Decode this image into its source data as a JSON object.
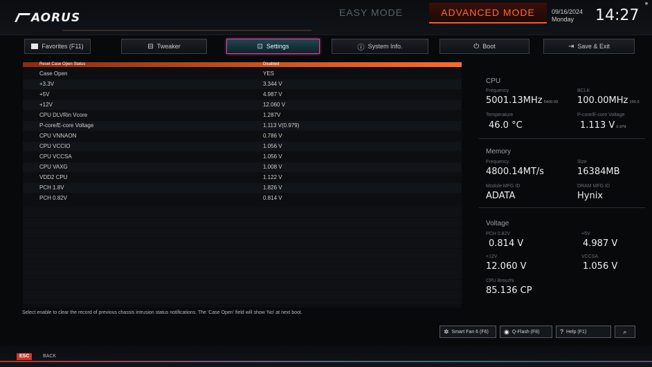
{
  "header": {
    "logo": "AORUS",
    "easy_mode": "EASY MODE",
    "advanced_mode": "ADVANCED MODE",
    "date": "09/16/2024",
    "day": "Monday",
    "time": "14:27"
  },
  "tabs": [
    {
      "label": "Favorites (F11)",
      "icon": "favorites-icon"
    },
    {
      "label": "Tweaker",
      "icon": "tweaker-icon"
    },
    {
      "label": "Settings",
      "icon": "settings-icon",
      "active": true
    },
    {
      "label": "System Info.",
      "icon": "info-icon"
    },
    {
      "label": "Boot",
      "icon": "power-icon"
    },
    {
      "label": "Save & Exit",
      "icon": "exit-icon"
    }
  ],
  "list": {
    "selected": {
      "name": "Reset Case Open Status",
      "value": "Disabled"
    },
    "rows": [
      {
        "name": "Case Open",
        "value": "YES"
      },
      {
        "name": "+3.3V",
        "value": "3.344 V"
      },
      {
        "name": "+5V",
        "value": "4.987 V"
      },
      {
        "name": "+12V",
        "value": "12.060 V"
      },
      {
        "name": "CPU DLVRin Vcore",
        "value": "1.287V"
      },
      {
        "name": "P-core/E-core Voltage",
        "value": "1.113 V(0.979)"
      },
      {
        "name": "CPU VNNAON",
        "value": "0.786 V"
      },
      {
        "name": "CPU VCCIO",
        "value": "1.056 V"
      },
      {
        "name": "CPU VCCSA",
        "value": "1.056 V"
      },
      {
        "name": "CPU VAXG",
        "value": "1.008 V"
      },
      {
        "name": "VDD2 CPU",
        "value": "1.122 V"
      },
      {
        "name": "PCH 1.8V",
        "value": "1.826 V"
      },
      {
        "name": "PCH 0.82V",
        "value": "0.814 V"
      }
    ]
  },
  "panel": {
    "cpu": {
      "title": "CPU",
      "freq_label": "Frequency",
      "freq": "5001.13MHz",
      "freq_sub": "5400.00",
      "bclk_label": "BCLK",
      "bclk": "100.00MHz",
      "bclk_sub": "100.0",
      "temp_label": "Temperature",
      "temp": "46.0 °C",
      "volt_label": "P-core/E-core Voltage",
      "volt": "1.113 V",
      "volt_sub": "0.979"
    },
    "memory": {
      "title": "Memory",
      "freq_label": "Frequency",
      "freq": "4800.14MT/s",
      "size_label": "Size",
      "size": "16384MB",
      "module_label": "Module MFG ID",
      "module": "ADATA",
      "dram_label": "DRAM MFG ID",
      "dram": "Hynix"
    },
    "voltage": {
      "title": "Voltage",
      "pch_label": "PCH 0.82V",
      "pch": "0.814 V",
      "v5_label": "+5V",
      "v5": "4.987 V",
      "v12_label": "+12V",
      "v12": "12.060 V",
      "vccsa_label": "VCCSA",
      "vccsa": "1.056 V",
      "cpu_label": "CPU Brouzhi",
      "cpu": "85.136 CP"
    }
  },
  "help_text": "Select enable to clear the record of previous chassis intrusion status notifications. The 'Case Open' field will show 'No' at next boot.",
  "buttons": {
    "smartfan": "Smart Fan 6 (F6)",
    "qflash": "Q-Flash (F8)",
    "help": "Help (F1)"
  },
  "footer": {
    "esc": "ESC",
    "back": "BACK"
  }
}
